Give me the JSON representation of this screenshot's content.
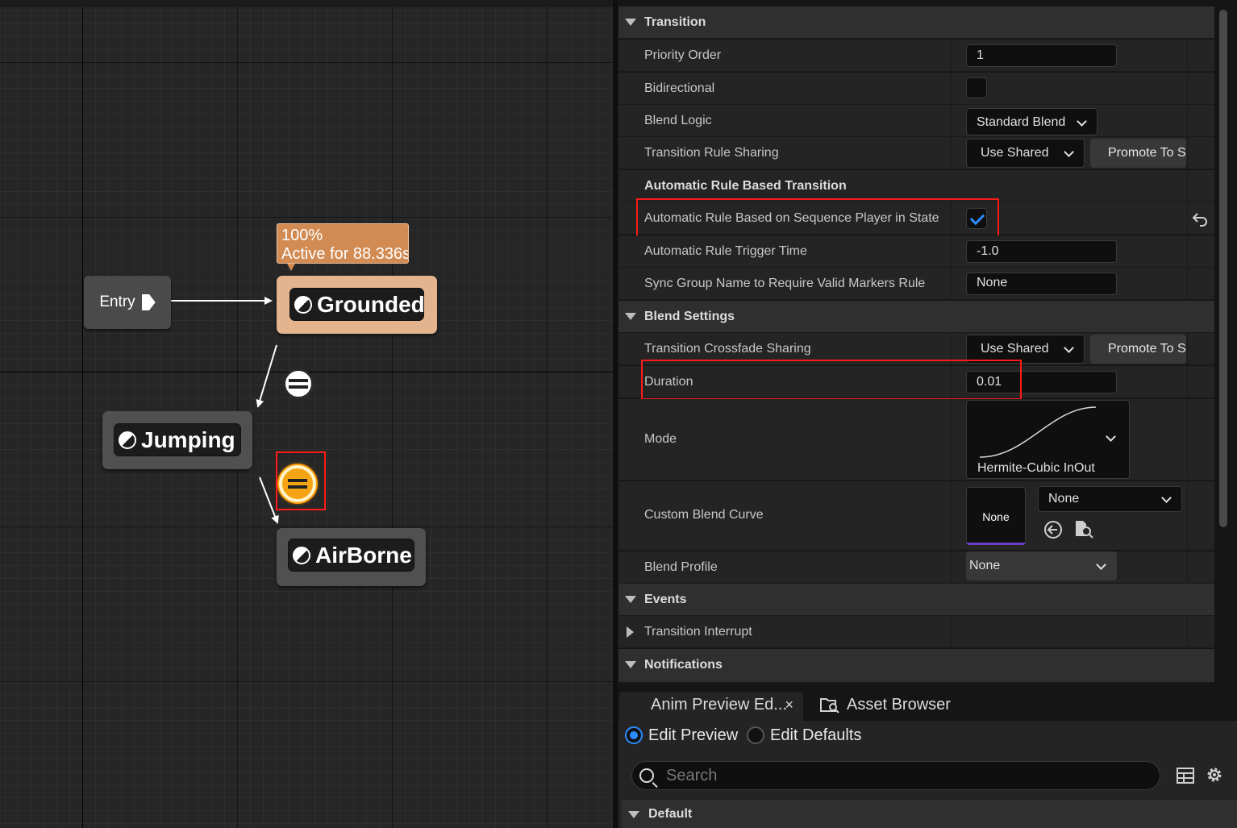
{
  "graph": {
    "entry_label": "Entry",
    "states": {
      "grounded": "Grounded",
      "jumping": "Jumping",
      "airborne": "AirBorne"
    },
    "tooltip": {
      "weight": "100%",
      "active": "Active for 88.336s"
    }
  },
  "details": {
    "categories": {
      "transition": "Transition",
      "blend_settings": "Blend Settings",
      "events": "Events",
      "notifications": "Notifications"
    },
    "rows": {
      "priority_order": {
        "name": "Priority Order",
        "value": "1"
      },
      "bidirectional": {
        "name": "Bidirectional",
        "checked": false
      },
      "blend_logic": {
        "name": "Blend Logic",
        "value": "Standard Blend"
      },
      "transition_rule_sharing": {
        "name": "Transition Rule Sharing",
        "value": "Use Shared",
        "button": "Promote To Shared"
      },
      "automatic_rule_header": {
        "name": "Automatic Rule Based Transition"
      },
      "automatic_rule": {
        "name": "Automatic Rule Based on Sequence Player in State",
        "checked": true
      },
      "trigger_time": {
        "name": "Automatic Rule Trigger Time",
        "value": "-1.0"
      },
      "sync_group": {
        "name": "Sync Group Name to Require Valid Markers Rule",
        "value": "None"
      },
      "crossfade_sharing": {
        "name": "Transition Crossfade Sharing",
        "value": "Use Shared",
        "button": "Promote To Shared"
      },
      "duration": {
        "name": "Duration",
        "value": "0.01"
      },
      "mode": {
        "name": "Mode",
        "value": "Hermite-Cubic InOut"
      },
      "custom_blend_curve": {
        "name": "Custom Blend Curve",
        "thumb": "None",
        "value": "None"
      },
      "blend_profile": {
        "name": "Blend Profile",
        "value": "None"
      },
      "transition_interrupt": {
        "name": "Transition Interrupt"
      }
    }
  },
  "bottom": {
    "tabs": [
      "Anim Preview Ed...",
      "Asset Browser"
    ],
    "tab_close": "×",
    "radio_options": [
      "Edit Preview",
      "Edit Defaults"
    ],
    "selected_radio": "Edit Preview",
    "search_placeholder": "Search",
    "default_category": "Default"
  },
  "icons": {
    "state": "state-machine-icon",
    "transition": "transition-icon",
    "reset": "reset-to-default-icon",
    "use_selected": "use-selected-asset-icon",
    "browse": "browse-asset-icon",
    "asset_browser": "asset-browser-icon",
    "search": "search-icon",
    "table_view": "table-view-icon",
    "settings": "gear-icon"
  },
  "colors": {
    "active_state": "#e3b48d",
    "tooltip": "#d18b53",
    "highlight": "#ff1a1a",
    "accent": "#2b8cff",
    "selected_transition": "#f4a414"
  }
}
